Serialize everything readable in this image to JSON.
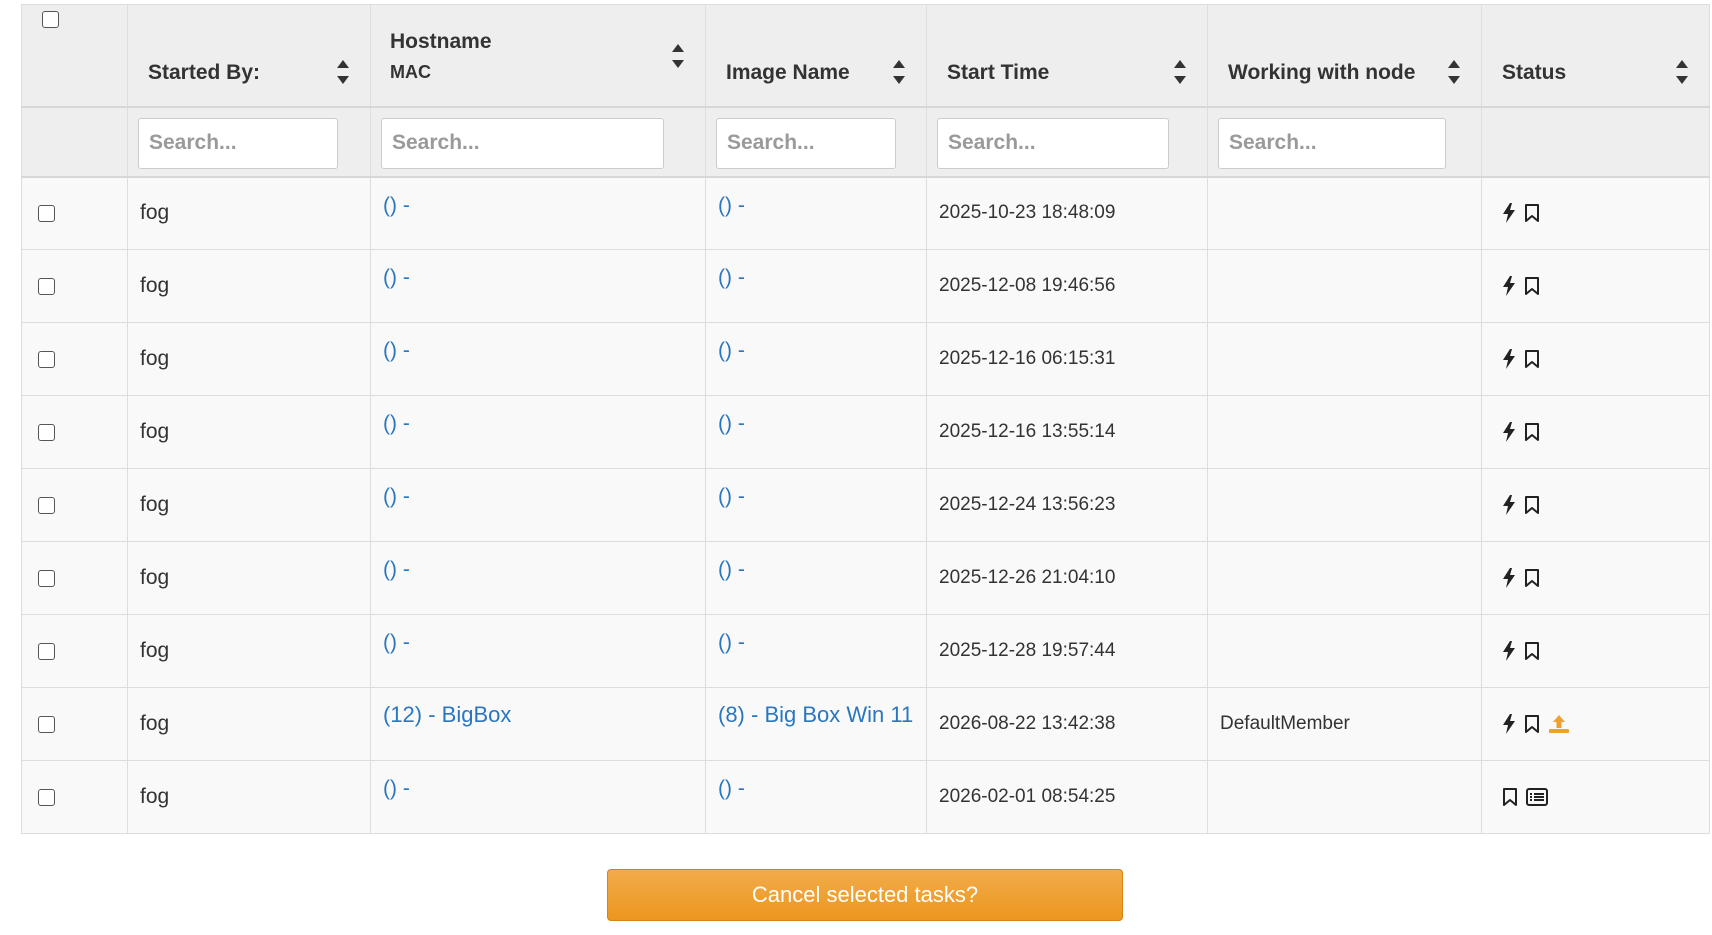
{
  "table": {
    "columns": [
      {
        "key": "started_by",
        "label": "Started By:"
      },
      {
        "key": "hostname",
        "label": "Hostname",
        "sub_label": "MAC"
      },
      {
        "key": "image_name",
        "label": "Image Name"
      },
      {
        "key": "start_time",
        "label": "Start Time"
      },
      {
        "key": "node",
        "label": "Working with node"
      },
      {
        "key": "status",
        "label": "Status"
      }
    ],
    "search_placeholder": "Search...",
    "rows": [
      {
        "started_by": "fog",
        "hostname": "() -",
        "image": "() -",
        "start_time": "2025-10-23 18:48:09",
        "node": "",
        "status_icons": [
          "bolt-icon",
          "bookmark-icon"
        ]
      },
      {
        "started_by": "fog",
        "hostname": "() -",
        "image": "() -",
        "start_time": "2025-12-08 19:46:56",
        "node": "",
        "status_icons": [
          "bolt-icon",
          "bookmark-icon"
        ]
      },
      {
        "started_by": "fog",
        "hostname": "() -",
        "image": "() -",
        "start_time": "2025-12-16 06:15:31",
        "node": "",
        "status_icons": [
          "bolt-icon",
          "bookmark-icon"
        ]
      },
      {
        "started_by": "fog",
        "hostname": "() -",
        "image": "() -",
        "start_time": "2025-12-16 13:55:14",
        "node": "",
        "status_icons": [
          "bolt-icon",
          "bookmark-icon"
        ]
      },
      {
        "started_by": "fog",
        "hostname": "() -",
        "image": "() -",
        "start_time": "2025-12-24 13:56:23",
        "node": "",
        "status_icons": [
          "bolt-icon",
          "bookmark-icon"
        ]
      },
      {
        "started_by": "fog",
        "hostname": "() -",
        "image": "() -",
        "start_time": "2025-12-26 21:04:10",
        "node": "",
        "status_icons": [
          "bolt-icon",
          "bookmark-icon"
        ]
      },
      {
        "started_by": "fog",
        "hostname": "() -",
        "image": "() -",
        "start_time": "2025-12-28 19:57:44",
        "node": "",
        "status_icons": [
          "bolt-icon",
          "bookmark-icon"
        ]
      },
      {
        "started_by": "fog",
        "hostname": "(12) - BigBox",
        "image": "(8) - Big Box Win 11",
        "start_time": "2026-08-22 13:42:38",
        "node": "DefaultMember",
        "status_icons": [
          "bolt-icon",
          "bookmark-icon",
          "upload-icon"
        ]
      },
      {
        "started_by": "fog",
        "hostname": "() -",
        "image": "() -",
        "start_time": "2026-02-01 08:54:25",
        "node": "",
        "status_icons": [
          "bookmark-icon",
          "list-icon"
        ]
      }
    ]
  },
  "colors": {
    "link": "#2a77c0",
    "header_bg": "#eeeeee",
    "row_bg": "#f9f9f9",
    "cancel_button": "#ec971f",
    "upload_icon": "#f0a030"
  },
  "cancel_button_label": "Cancel selected tasks?"
}
